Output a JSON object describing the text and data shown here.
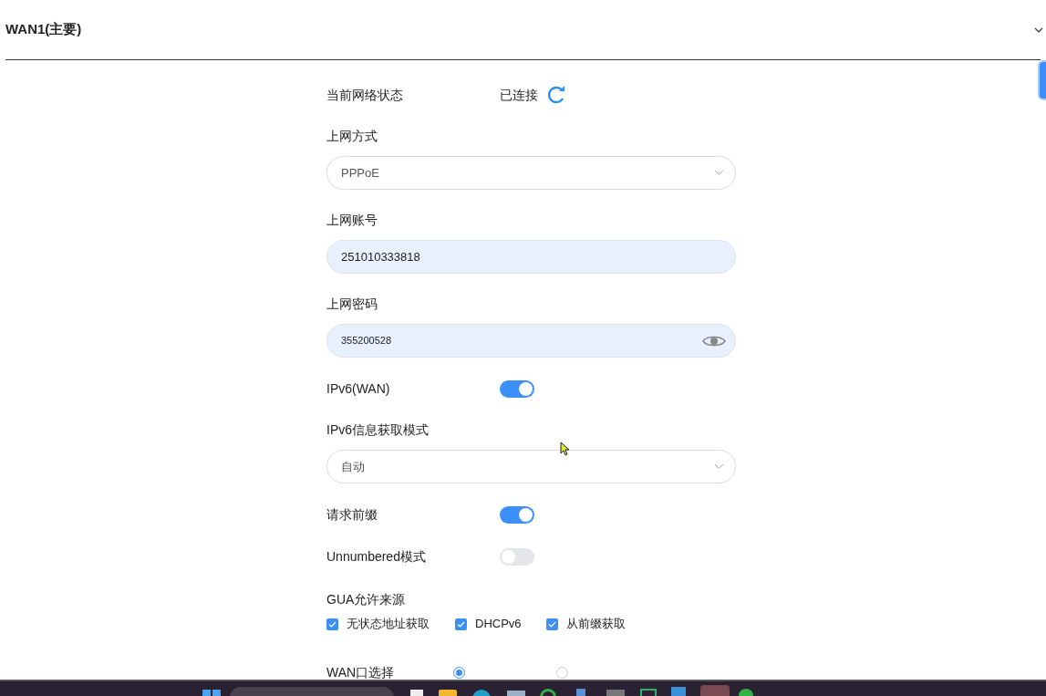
{
  "section": {
    "title": "WAN1(主要)",
    "expanded": true
  },
  "rows": [
    {
      "kind": "status",
      "label": "当前网络状态",
      "value": "已连接"
    },
    {
      "kind": "select",
      "label": "上网方式",
      "value": "PPPoE"
    },
    {
      "kind": "input",
      "label": "上网账号",
      "value": "251010333818"
    },
    {
      "kind": "password",
      "label": "上网密码",
      "value": "355200528"
    },
    {
      "kind": "toggle",
      "label": "IPv6(WAN)",
      "on": true
    },
    {
      "kind": "select",
      "label": "IPv6信息获取模式",
      "value": "自动"
    },
    {
      "kind": "toggle",
      "label": "请求前缀",
      "on": true
    },
    {
      "kind": "toggle",
      "label": "Unnumbered模式",
      "on": false
    },
    {
      "kind": "checks",
      "label": "GUA允许来源",
      "options": [
        {
          "label": "无状态地址获取",
          "checked": true
        },
        {
          "label": "DHCPv6",
          "checked": true
        },
        {
          "label": "从前缀获取",
          "checked": true
        }
      ]
    },
    {
      "kind": "radios",
      "label": "WAN口选择",
      "options": [
        {
          "selected": true
        },
        {
          "selected": false
        }
      ]
    }
  ]
}
